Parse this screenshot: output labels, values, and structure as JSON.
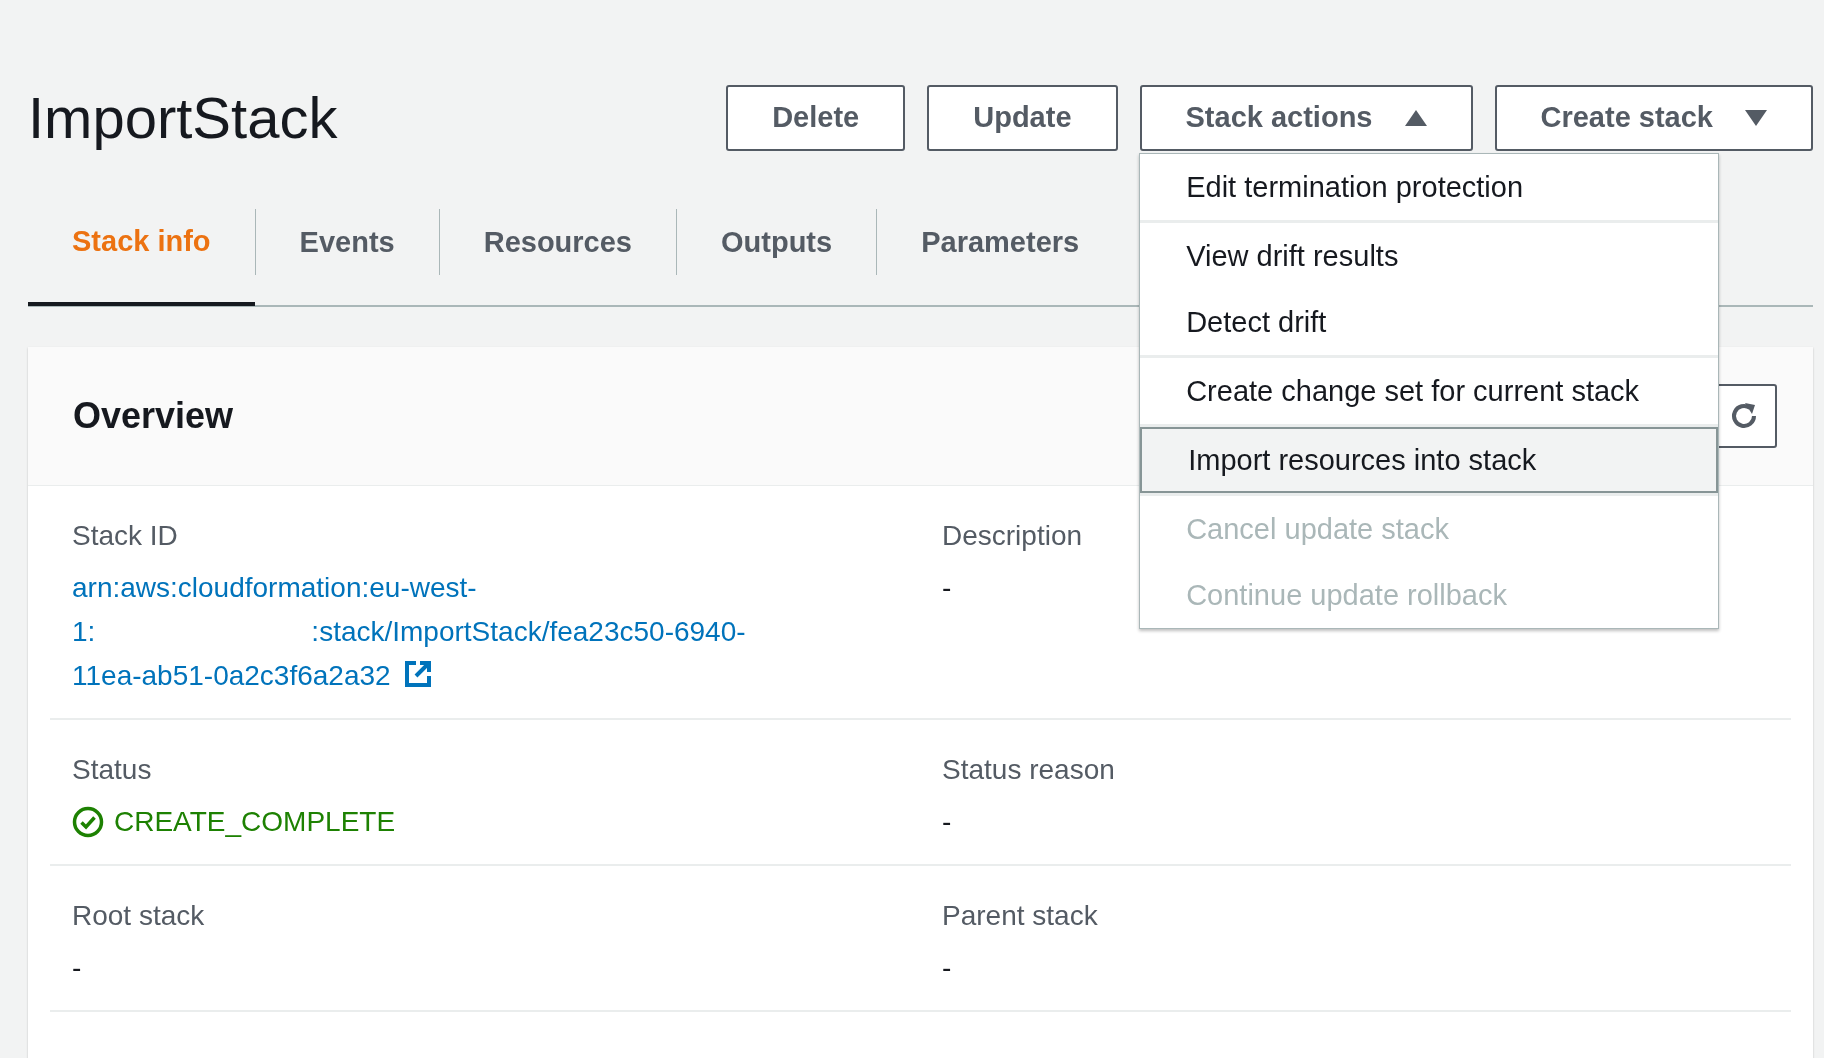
{
  "page_title": "ImportStack",
  "buttons": [
    {
      "label": "Delete",
      "kind": "plain"
    },
    {
      "label": "Update",
      "kind": "plain"
    },
    {
      "label": "Stack actions",
      "kind": "menu",
      "expanded": true
    },
    {
      "label": "Create stack",
      "kind": "menu",
      "expanded": false
    }
  ],
  "stack_actions_menu": {
    "groups": [
      [
        {
          "label": "Edit termination protection",
          "selected": false,
          "disabled": false
        }
      ],
      [
        {
          "label": "View drift results",
          "selected": false,
          "disabled": false
        },
        {
          "label": "Detect drift",
          "selected": false,
          "disabled": false
        }
      ],
      [
        {
          "label": "Create change set for current stack",
          "selected": false,
          "disabled": false
        }
      ],
      [
        {
          "label": "Import resources into stack",
          "selected": true,
          "disabled": false
        }
      ],
      [
        {
          "label": "Cancel update stack",
          "selected": false,
          "disabled": true
        },
        {
          "label": "Continue update rollback",
          "selected": false,
          "disabled": true
        }
      ]
    ]
  },
  "tabs": [
    {
      "label": "Stack info",
      "selected": true
    },
    {
      "label": "Events",
      "selected": false
    },
    {
      "label": "Resources",
      "selected": false
    },
    {
      "label": "Outputs",
      "selected": false
    },
    {
      "label": "Parameters",
      "selected": false
    }
  ],
  "overview": {
    "title": "Overview",
    "rows": [
      [
        {
          "label": "Stack ID",
          "kind": "link",
          "lines": [
            [
              "arn:aws:cloudformation:eu-west-"
            ],
            [
              "1:",
              ":stack/ImportStack/fea23c50-6940-"
            ],
            [
              "11ea-ab51-0a2c3f6a2a32"
            ]
          ]
        },
        {
          "label": "Description",
          "kind": "text",
          "value": "-"
        }
      ],
      [
        {
          "label": "Status",
          "kind": "status",
          "value": "CREATE_COMPLETE"
        },
        {
          "label": "Status reason",
          "kind": "text",
          "value": "-"
        }
      ],
      [
        {
          "label": "Root stack",
          "kind": "text",
          "value": "-"
        },
        {
          "label": "Parent stack",
          "kind": "text",
          "value": "-"
        }
      ]
    ]
  }
}
